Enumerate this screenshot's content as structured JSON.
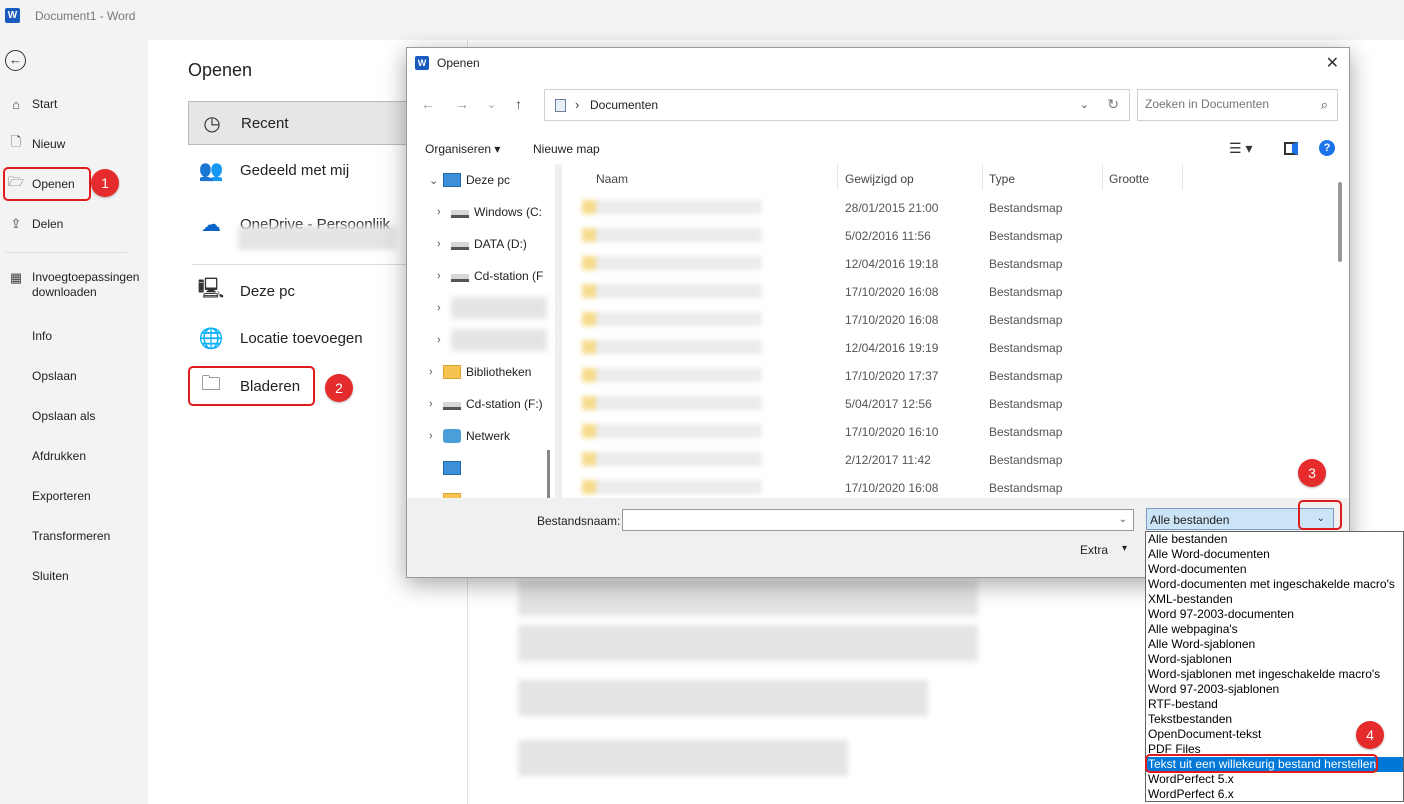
{
  "window": {
    "title": "Document1  -  Word",
    "app_icon": "word-logo"
  },
  "nav": {
    "back_icon": "back-arrow-icon",
    "items": [
      {
        "label": "Start",
        "icon": "home-icon"
      },
      {
        "label": "Nieuw",
        "icon": "new-doc-icon"
      },
      {
        "label": "Openen",
        "icon": "folder-open-icon"
      },
      {
        "label": "Delen",
        "icon": "share-icon"
      },
      {
        "label": "Invoegtoepassingen downloaden",
        "icon": "addins-icon"
      },
      {
        "label": "Info"
      },
      {
        "label": "Opslaan"
      },
      {
        "label": "Opslaan als"
      },
      {
        "label": "Afdrukken"
      },
      {
        "label": "Exporteren"
      },
      {
        "label": "Transformeren"
      },
      {
        "label": "Sluiten"
      }
    ]
  },
  "open_page": {
    "title": "Openen",
    "locations": [
      {
        "label": "Recent",
        "icon": "clock-icon"
      },
      {
        "label": "Gedeeld met mij",
        "icon": "people-icon"
      },
      {
        "label": "OneDrive - Persoonlijk",
        "icon": "onedrive-icon"
      },
      {
        "label": "Deze pc",
        "icon": "pc-icon"
      },
      {
        "label": "Locatie toevoegen",
        "icon": "globe-add-icon"
      },
      {
        "label": "Bladeren",
        "icon": "folder-icon"
      }
    ]
  },
  "badges": [
    "1",
    "2",
    "3",
    "4"
  ],
  "dialog": {
    "title": "Openen",
    "close_icon": "close-icon",
    "address": {
      "path": "Documenten"
    },
    "search_placeholder": "Zoeken in Documenten",
    "toolbar": {
      "organize": "Organiseren",
      "new_folder": "Nieuwe map"
    },
    "tree": [
      {
        "label": "Deze pc",
        "icon": "pc",
        "indent": 0,
        "expanded": true
      },
      {
        "label": "Windows (C:",
        "icon": "drive",
        "indent": 1
      },
      {
        "label": "DATA (D:)",
        "icon": "drive",
        "indent": 1
      },
      {
        "label": "Cd-station (F",
        "icon": "drive",
        "indent": 1
      },
      {
        "label": "",
        "icon": "",
        "indent": 1
      },
      {
        "label": "",
        "icon": "",
        "indent": 1
      },
      {
        "label": "Bibliotheken",
        "icon": "folder",
        "indent": 0
      },
      {
        "label": "Cd-station (F:)",
        "icon": "drive",
        "indent": 0
      },
      {
        "label": "Netwerk",
        "icon": "net",
        "indent": 0
      },
      {
        "label": "",
        "icon": "pc",
        "indent": 0
      },
      {
        "label": "",
        "icon": "folder",
        "indent": 0
      }
    ],
    "columns": [
      "Naam",
      "Gewijzigd op",
      "Type",
      "Grootte"
    ],
    "rows": [
      {
        "date": "28/01/2015 21:00",
        "type": "Bestandsmap"
      },
      {
        "date": "5/02/2016 11:56",
        "type": "Bestandsmap"
      },
      {
        "date": "12/04/2016 19:18",
        "type": "Bestandsmap"
      },
      {
        "date": "17/10/2020 16:08",
        "type": "Bestandsmap"
      },
      {
        "date": "17/10/2020 16:08",
        "type": "Bestandsmap"
      },
      {
        "date": "12/04/2016 19:19",
        "type": "Bestandsmap"
      },
      {
        "date": "17/10/2020 17:37",
        "type": "Bestandsmap"
      },
      {
        "date": "5/04/2017 12:56",
        "type": "Bestandsmap"
      },
      {
        "date": "17/10/2020 16:10",
        "type": "Bestandsmap"
      },
      {
        "date": "2/12/2017 11:42",
        "type": "Bestandsmap"
      },
      {
        "date": "17/10/2020 16:08",
        "type": "Bestandsmap"
      }
    ],
    "filename_label": "Bestandsnaam:",
    "filename_value": "",
    "filetype_selected": "Alle bestanden",
    "extra_label": "Extra",
    "filetype_options": [
      "Alle bestanden",
      "Alle Word-documenten",
      "Word-documenten",
      "Word-documenten met ingeschakelde macro's",
      "XML-bestanden",
      "Word 97-2003-documenten",
      "Alle webpagina's",
      "Alle Word-sjablonen",
      "Word-sjablonen",
      "Word-sjablonen met ingeschakelde macro's",
      "Word 97-2003-sjablonen",
      "RTF-bestand",
      "Tekstbestanden",
      "OpenDocument-tekst",
      "PDF Files",
      "Tekst uit een willekeurig bestand herstellen",
      "WordPerfect 5.x",
      "WordPerfect 6.x"
    ],
    "highlighted_option": "Tekst uit een willekeurig bestand herstellen"
  }
}
